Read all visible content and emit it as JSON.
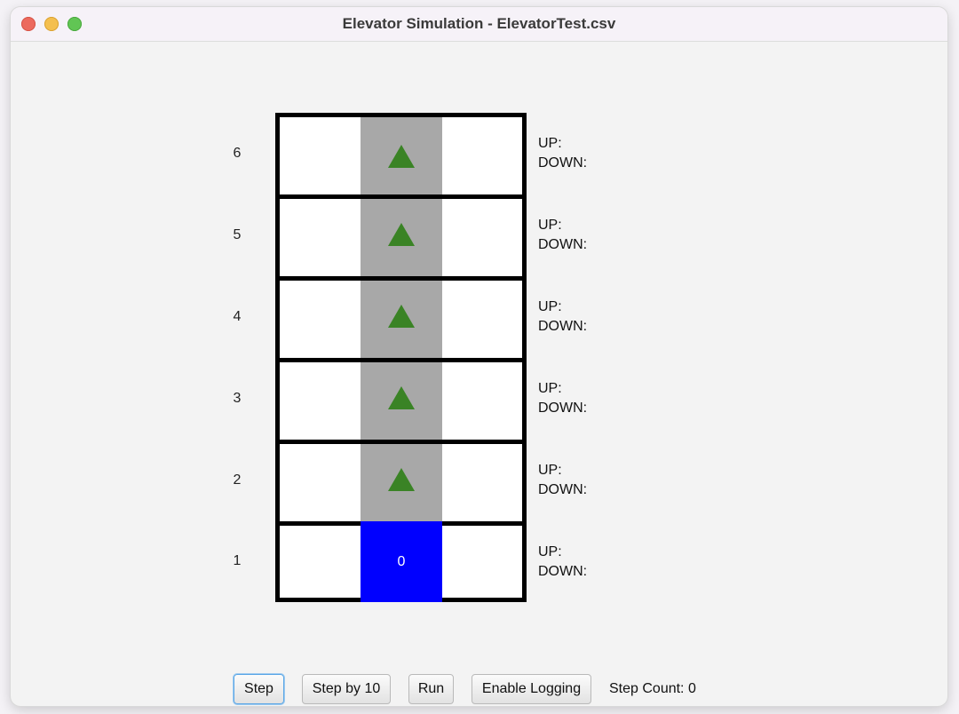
{
  "window": {
    "title": "Elevator Simulation - ElevatorTest.csv"
  },
  "floors": [
    {
      "number": "6",
      "up_label": "UP:",
      "down_label": "DOWN:",
      "indicator_icon": "up-arrow-icon"
    },
    {
      "number": "5",
      "up_label": "UP:",
      "down_label": "DOWN:",
      "indicator_icon": "up-arrow-icon"
    },
    {
      "number": "4",
      "up_label": "UP:",
      "down_label": "DOWN:",
      "indicator_icon": "up-arrow-icon"
    },
    {
      "number": "3",
      "up_label": "UP:",
      "down_label": "DOWN:",
      "indicator_icon": "up-arrow-icon"
    },
    {
      "number": "2",
      "up_label": "UP:",
      "down_label": "DOWN:",
      "indicator_icon": "up-arrow-icon"
    },
    {
      "number": "1",
      "up_label": "UP:",
      "down_label": "DOWN:",
      "indicator_icon": null
    }
  ],
  "elevator": {
    "current_floor": "1",
    "passenger_count": "0",
    "car_color": "#0000ff",
    "shaft_color": "#a8a8a8",
    "arrow_color": "#3a8325"
  },
  "controls": {
    "step_label": "Step",
    "step_by_10_label": "Step by 10",
    "run_label": "Run",
    "enable_logging_label": "Enable Logging",
    "step_count_text": "Step Count: 0"
  }
}
